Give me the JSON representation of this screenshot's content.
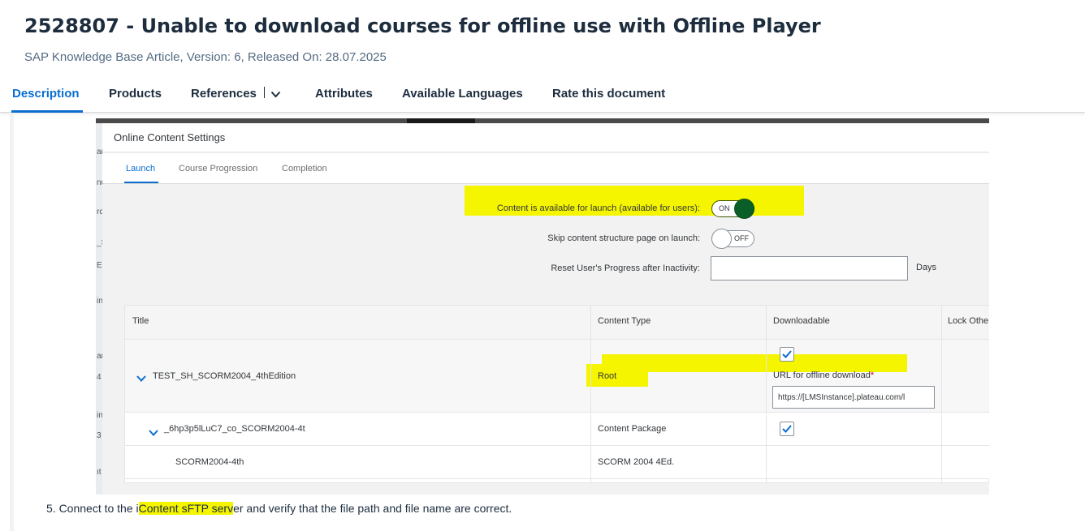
{
  "article": {
    "title": "2528807 - Unable to download courses for offline use with Offline Player",
    "subtitle": "SAP Knowledge Base Article, Version: 6, Released On: 28.07.2025"
  },
  "tabs": {
    "description": "Description",
    "products": "Products",
    "references": "References",
    "attributes": "Attributes",
    "available_languages": "Available Languages",
    "rate": "Rate this document"
  },
  "screenshot": {
    "dialog_title": "Online Content Settings",
    "tabs": {
      "launch": "Launch",
      "progression": "Course Progression",
      "completion": "Completion"
    },
    "form": {
      "available_label": "Content is available for launch (available for users):",
      "available_toggle": "ON",
      "skip_label": "Skip content structure page on launch:",
      "skip_toggle": "OFF",
      "reset_label": "Reset User's Progress after Inactivity:",
      "reset_value": "",
      "days": "Days"
    },
    "table": {
      "headers": {
        "title": "Title",
        "content_type": "Content Type",
        "downloadable": "Downloadable",
        "lock": "Lock Othe"
      },
      "rows": [
        {
          "title": "TEST_SH_SCORM2004_4thEdition",
          "content_type": "Root",
          "url_label": "URL for offline download",
          "url_required": "*",
          "url_value": "https://[LMSInstance].plateau.com/l"
        },
        {
          "title": "_6hp3p5lLuC7_co_SCORM2004-4t",
          "content_type": "Content Package"
        },
        {
          "title": "SCORM2004-4th",
          "content_type": "SCORM 2004 4Ed."
        }
      ]
    },
    "background_chars": [
      "ar",
      "nu",
      "rc",
      "_S",
      "E",
      "in",
      "ar",
      "4",
      "in",
      "3",
      "ıt"
    ]
  },
  "step": {
    "prefix": "5. Connect to the i",
    "highlight": "Content sFTP serv",
    "suffix": "er and verify that the file path and file name are correct."
  },
  "colors": {
    "accent": "#0a6ed1",
    "highlight": "#f5f500",
    "toggle_on": "#0a5f28",
    "text": "#1d2d3e"
  }
}
